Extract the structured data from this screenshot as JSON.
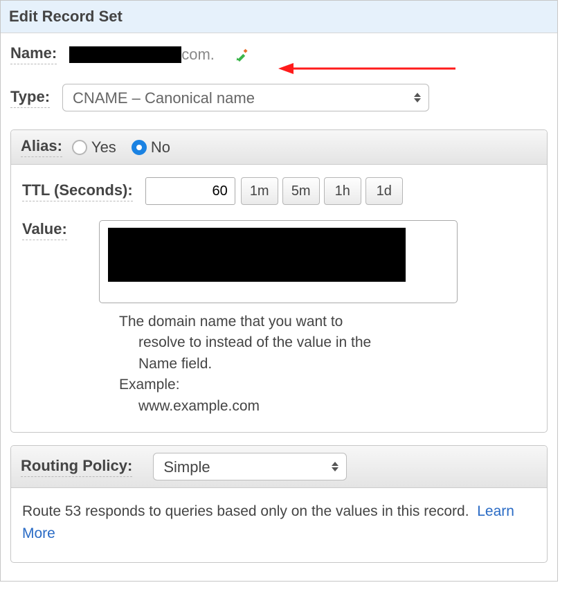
{
  "header": {
    "title": "Edit Record Set"
  },
  "name": {
    "label": "Name:",
    "redacted": true,
    "suffix": "com."
  },
  "type": {
    "label": "Type:",
    "selected": "CNAME – Canonical name"
  },
  "alias": {
    "label": "Alias:",
    "options": {
      "yes": "Yes",
      "no": "No"
    },
    "selected": "no"
  },
  "ttl": {
    "label": "TTL (Seconds):",
    "value": "60",
    "presets": {
      "m1": "1m",
      "m5": "5m",
      "h1": "1h",
      "d1": "1d"
    }
  },
  "value": {
    "label": "Value:",
    "redacted": true,
    "help_line1": "The domain name that you want to",
    "help_line2": "resolve to instead of the value in the",
    "help_line3": "Name field.",
    "help_example_label": "Example:",
    "help_example_value": "www.example.com"
  },
  "routing_policy": {
    "label": "Routing Policy:",
    "selected": "Simple",
    "help": "Route 53 responds to queries based only on the values in this record.",
    "learn_more": "Learn More"
  },
  "icons": {
    "pencil": "edit-pencil-icon",
    "arrow": "red-arrow-annotation"
  }
}
